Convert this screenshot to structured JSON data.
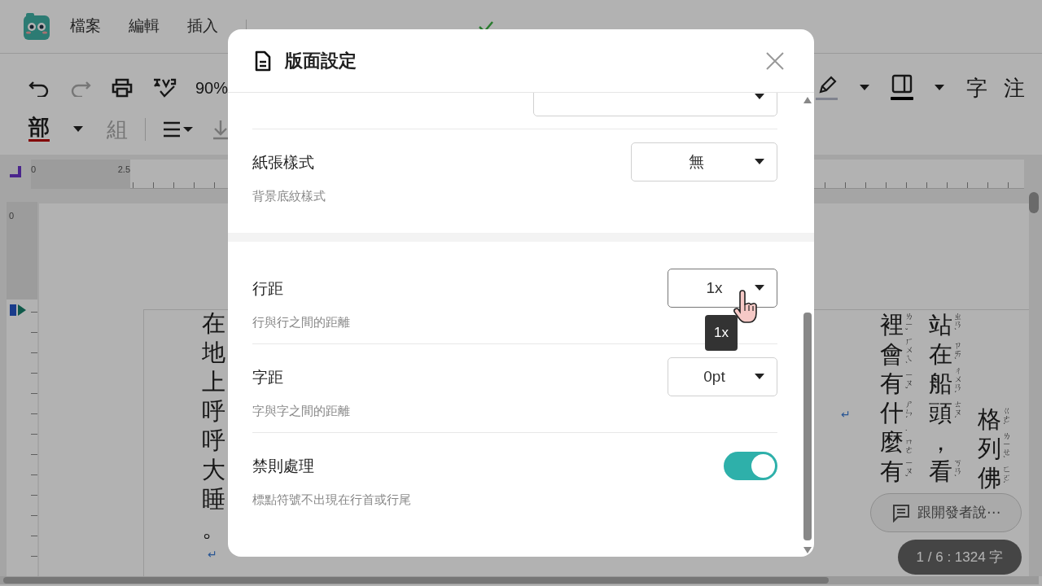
{
  "menubar": {
    "menus": [
      "檔案",
      "編輯",
      "插入"
    ]
  },
  "toolbar": {
    "row1_left": [
      {
        "kind": "undo",
        "disabled": false
      },
      {
        "kind": "redo",
        "disabled": true
      },
      {
        "kind": "print",
        "disabled": false
      },
      {
        "kind": "spellcheck",
        "disabled": false
      },
      {
        "kind": "zoom",
        "label": "90%",
        "disabled": false
      }
    ],
    "row1_right": [
      {
        "kind": "highlight",
        "disabled": false
      },
      {
        "kind": "caret",
        "disabled": false
      },
      {
        "kind": "border",
        "disabled": false
      },
      {
        "kind": "caret",
        "disabled": false
      },
      {
        "kind": "text",
        "label": "字",
        "disabled": false
      },
      {
        "kind": "text",
        "label": "注",
        "disabled": false
      }
    ],
    "row2": [
      {
        "kind": "ruby",
        "label": "部",
        "disabled": false
      },
      {
        "kind": "caret",
        "disabled": false
      },
      {
        "kind": "text",
        "label": "組",
        "disabled": true
      },
      {
        "kind": "divider",
        "disabled": false
      },
      {
        "kind": "align",
        "disabled": false
      },
      {
        "kind": "download",
        "disabled": true
      }
    ]
  },
  "rulers": {
    "top_labels": [
      "0",
      "2.5"
    ],
    "left_labels": [
      "0"
    ]
  },
  "document": {
    "left_column": [
      "在",
      "地",
      "上",
      "呼",
      "呼",
      "大",
      "睡",
      "。"
    ],
    "right_columns": [
      {
        "cells": [
          {
            "char": "裡",
            "zhuyin": "ㄌㄧˇ"
          },
          {
            "char": "會",
            "zhuyin": "ㄏㄨㄟˋ"
          },
          {
            "char": "有",
            "zhuyin": "ㄧㄡˇ"
          },
          {
            "char": "什",
            "zhuyin": "ㄕㄣˊ"
          },
          {
            "char": "麼",
            "zhuyin": "˙ㄇㄜ"
          },
          {
            "char": "有",
            "zhuyin": "ㄧㄡˇ"
          }
        ]
      },
      {
        "cells": [
          {
            "char": "站",
            "zhuyin": "ㄓㄢˋ"
          },
          {
            "char": "在",
            "zhuyin": "ㄗㄞˋ"
          },
          {
            "char": "船",
            "zhuyin": "ㄔㄨㄢˊ"
          },
          {
            "char": "頭",
            "zhuyin": "ㄊㄡˊ"
          },
          {
            "char": "，"
          },
          {
            "char": "看",
            "zhuyin": "ㄎㄢˋ"
          }
        ]
      },
      {
        "cells": [
          {
            "char": "格",
            "zhuyin": "ㄍㄜˊ"
          },
          {
            "char": "列",
            "zhuyin": "ㄌㄧㄝˋ"
          },
          {
            "char": "佛",
            "zhuyin": "ㄈㄛˊ"
          }
        ]
      }
    ],
    "pilcrows": [
      "↵",
      "↵"
    ]
  },
  "dialog": {
    "title": "版面設定",
    "sections": [
      {
        "rows": [
          {
            "kind": "select",
            "hovered": false
          },
          {
            "kind": "select",
            "label": "紙張樣式",
            "description": "背景底紋樣式",
            "value": "無",
            "hovered": false
          }
        ]
      },
      {
        "rows": [
          {
            "kind": "select",
            "label": "行距",
            "description": "行與行之間的距離",
            "value": "1x",
            "hovered": true,
            "tooltip": "1x"
          },
          {
            "kind": "select",
            "label": "字距",
            "description": "字與字之間的距離",
            "value": "0pt",
            "hovered": false
          },
          {
            "kind": "toggle",
            "label": "禁則處理",
            "description": "標點符號不出現在行首或行尾",
            "on": true
          }
        ]
      }
    ]
  },
  "feedback_button": {
    "label": "跟開發者說⋯"
  },
  "status": {
    "label": "1 / 6 : 1324 字"
  }
}
